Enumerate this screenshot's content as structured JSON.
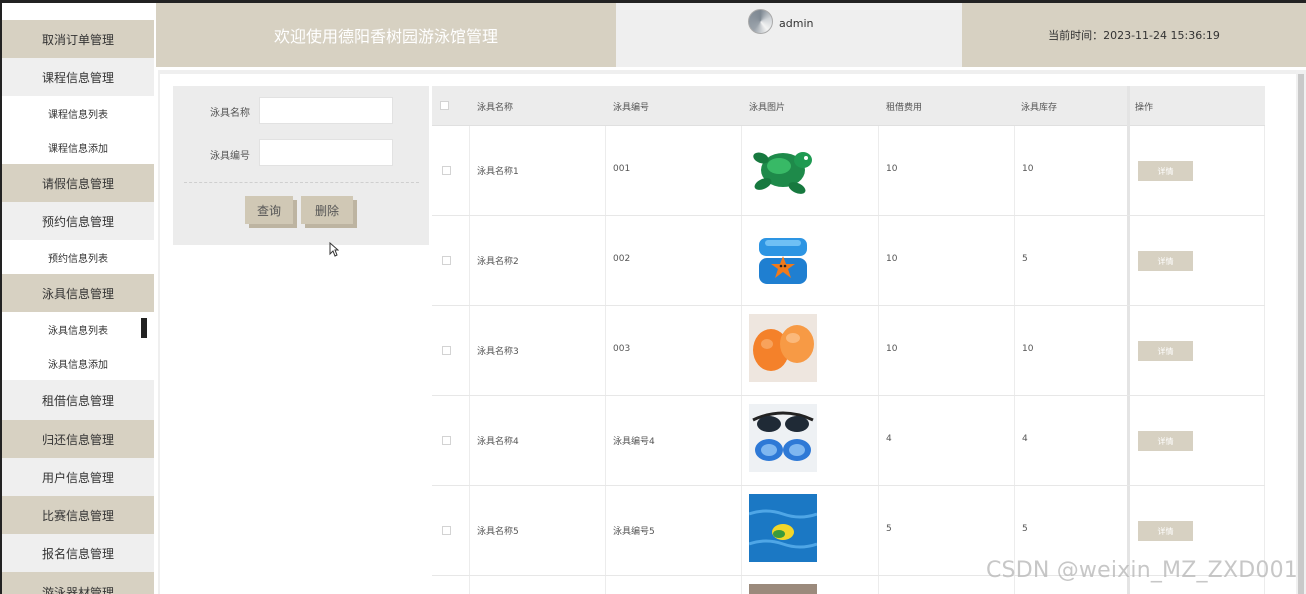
{
  "sidebar": {
    "items": [
      {
        "label": "取消订单管理",
        "kind": "group"
      },
      {
        "label": "课程信息管理",
        "kind": "plain"
      },
      {
        "label": "课程信息列表",
        "kind": "sub"
      },
      {
        "label": "课程信息添加",
        "kind": "sub"
      },
      {
        "label": "请假信息管理",
        "kind": "group"
      },
      {
        "label": "预约信息管理",
        "kind": "plain"
      },
      {
        "label": "预约信息列表",
        "kind": "sub"
      },
      {
        "label": "泳具信息管理",
        "kind": "group"
      },
      {
        "label": "泳具信息列表",
        "kind": "sub",
        "active": true
      },
      {
        "label": "泳具信息添加",
        "kind": "sub"
      },
      {
        "label": "租借信息管理",
        "kind": "plain"
      },
      {
        "label": "归还信息管理",
        "kind": "group"
      },
      {
        "label": "用户信息管理",
        "kind": "plain"
      },
      {
        "label": "比赛信息管理",
        "kind": "group"
      },
      {
        "label": "报名信息管理",
        "kind": "plain"
      },
      {
        "label": "游泳器材管理",
        "kind": "group"
      }
    ]
  },
  "header": {
    "welcome": "欢迎使用德阳香树园游泳馆管理",
    "username": "admin",
    "time_label": "当前时间：",
    "time_value": "2023-11-24 15:36:19"
  },
  "search": {
    "name_label": "泳具名称",
    "code_label": "泳具编号",
    "name_value": "",
    "code_value": "",
    "query_button": "查询",
    "delete_button": "删除"
  },
  "table": {
    "columns": [
      "泳具名称",
      "泳具编号",
      "泳具图片",
      "租借费用",
      "泳具库存",
      "操作"
    ],
    "rows": [
      {
        "name": "泳具名称1",
        "code": "001",
        "image": "green-turtle-float",
        "fee": "10",
        "stock": "10",
        "action": "详情"
      },
      {
        "name": "泳具名称2",
        "code": "002",
        "image": "blue-starfish-armbands",
        "fee": "10",
        "stock": "5",
        "action": "详情"
      },
      {
        "name": "泳具名称3",
        "code": "003",
        "image": "orange-armbands",
        "fee": "10",
        "stock": "10",
        "action": "详情"
      },
      {
        "name": "泳具名称4",
        "code": "泳具编号4",
        "image": "swim-goggles",
        "fee": "4",
        "stock": "4",
        "action": "详情"
      },
      {
        "name": "泳具名称5",
        "code": "泳具编号5",
        "image": "toy-in-pool",
        "fee": "5",
        "stock": "5",
        "action": "详情"
      }
    ]
  },
  "watermark": "CSDN @weixin_MZ_ZXD001",
  "colors": {
    "accent": "#d7d1c2",
    "panel": "#ececec",
    "button": "#d0c8b5"
  }
}
